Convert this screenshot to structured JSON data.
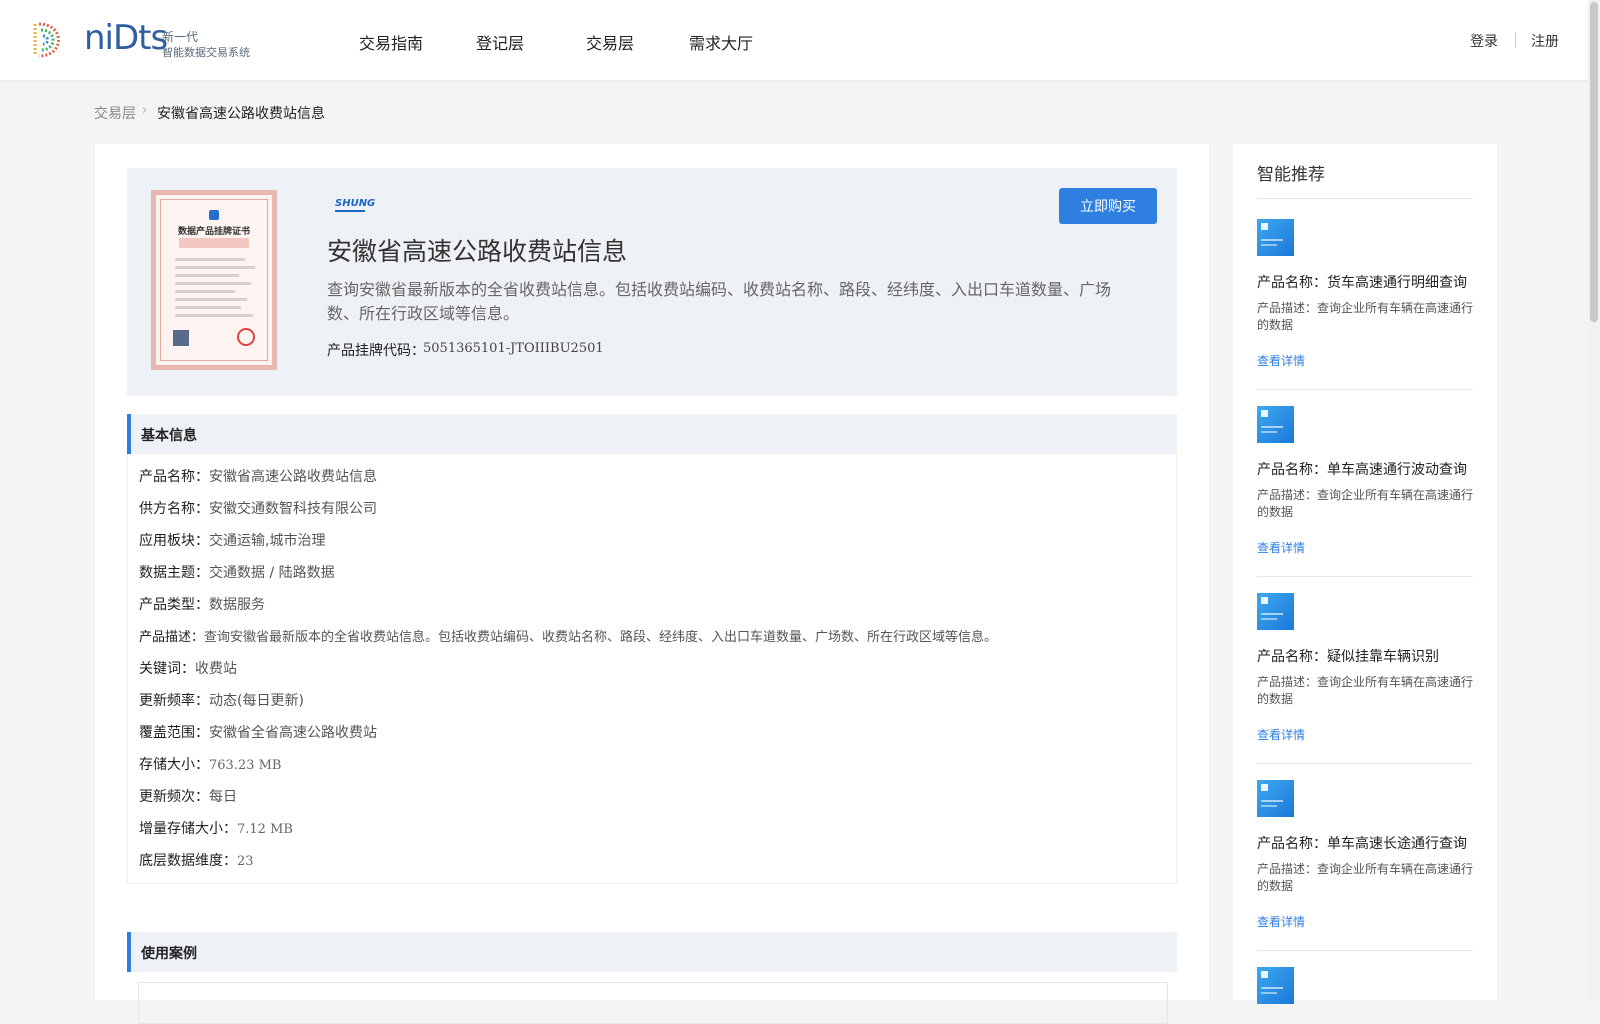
{
  "brand": {
    "logo_text": "niDts",
    "tagline_1": "新一代",
    "tagline_2": "智能数据交易系统"
  },
  "nav": {
    "items": [
      "交易指南",
      "登记层",
      "交易层",
      "需求大厅"
    ],
    "login": "登录",
    "register": "注册"
  },
  "breadcrumb": {
    "root": "交易层",
    "current": "安徽省高速公路收费站信息"
  },
  "product": {
    "certificate_title": "数据产品挂牌证书",
    "brand_mark": "SHUNG",
    "title": "安徽省高速公路收费站信息",
    "description": "查询安徽省最新版本的全省收费站信息。包括收费站编码、收费站名称、路段、经纬度、入出口车道数量、广场数、所在行政区域等信息。",
    "code_label": "产品挂牌代码：",
    "code_value": "5051365101-JTOIIIBU2501",
    "buy_button": "立即购买"
  },
  "basic_info": {
    "section_title": "基本信息",
    "rows": [
      {
        "key": "产品名称：",
        "value": "安徽省高速公路收费站信息"
      },
      {
        "key": "供方名称：",
        "value": "安徽交通数智科技有限公司"
      },
      {
        "key": "应用板块：",
        "value": "交通运输,城市治理"
      },
      {
        "key": "数据主题：",
        "value": "交通数据 / 陆路数据"
      },
      {
        "key": "产品类型：",
        "value": "数据服务"
      },
      {
        "key": "产品描述：",
        "value": "查询安徽省最新版本的全省收费站信息。包括收费站编码、收费站名称、路段、经纬度、入出口车道数量、广场数、所在行政区域等信息。"
      },
      {
        "key": "关键词：",
        "value": "收费站"
      },
      {
        "key": "更新频率：",
        "value": "动态(每日更新)"
      },
      {
        "key": "覆盖范围：",
        "value": "安徽省全省高速公路收费站"
      },
      {
        "key": "存储大小：",
        "value": "763.23 MB"
      },
      {
        "key": "更新频次：",
        "value": "每日"
      },
      {
        "key": "增量存储大小：",
        "value": "7.12 MB"
      },
      {
        "key": "底层数据维度：",
        "value": "23"
      }
    ]
  },
  "use_cases": {
    "section_title": "使用案例"
  },
  "recommend": {
    "title": "智能推荐",
    "items": [
      {
        "name": "产品名称：货车高速通行明细查询",
        "desc": "产品描述：查询企业所有车辆在高速通行的数据",
        "link": "查看详情"
      },
      {
        "name": "产品名称：单车高速通行波动查询",
        "desc": "产品描述：查询企业所有车辆在高速通行的数据",
        "link": "查看详情"
      },
      {
        "name": "产品名称：疑似挂靠车辆识别",
        "desc": "产品描述：查询企业所有车辆在高速通行的数据",
        "link": "查看详情"
      },
      {
        "name": "产品名称：单车高速长途通行查询",
        "desc": "产品描述：查询企业所有车辆在高速通行的数据",
        "link": "查看详情"
      }
    ]
  }
}
